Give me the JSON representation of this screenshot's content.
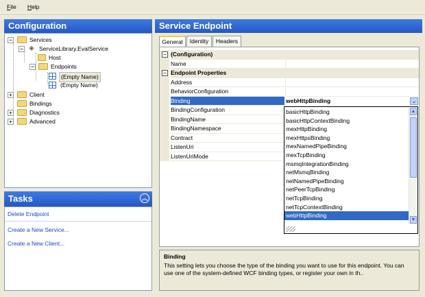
{
  "menu": {
    "file": {
      "underline": "F",
      "rest": "ile"
    },
    "help": {
      "underline": "H",
      "rest": "elp"
    }
  },
  "configuration": {
    "title": "Configuration",
    "tree": {
      "services": "Services",
      "service_library": "ServiceLibrary.EvalService",
      "host": "Host",
      "endpoints": "Endpoints",
      "empty_name_1": "(Empty Name)",
      "empty_name_2": "(Empty Name)",
      "client": "Client",
      "bindings": "Bindings",
      "diagnostics": "Diagnostics",
      "advanced": "Advanced"
    }
  },
  "tasks": {
    "title": "Tasks",
    "delete_endpoint": "Delete Endpoint",
    "create_service": "Create a New Service...",
    "create_client": "Create a New Client..."
  },
  "service_endpoint": {
    "title": "Service Endpoint",
    "tabs": [
      "General",
      "Identity",
      "Headers"
    ]
  },
  "properties": {
    "cat_configuration": "(Configuration)",
    "name": "Name",
    "cat_endpoint": "Endpoint Properties",
    "address": "Address",
    "behavior_configuration": "BehaviorConfiguration",
    "binding": "Binding",
    "binding_configuration": "BindingConfiguration",
    "binding_name": "BindingName",
    "binding_namespace": "BindingNamespace",
    "contract": "Contract",
    "listen_uri": "ListenUri",
    "listen_uri_mode": "ListenUriMode"
  },
  "binding_combo": {
    "value": "webHttpBinding",
    "options": [
      "basicHttpBinding",
      "basicHttpContextBinding",
      "mexHttpBinding",
      "mexHttpsBinding",
      "mexNamedPipeBinding",
      "mexTcpBinding",
      "msmqIntegrationBinding",
      "netMsmqBinding",
      "netNamedPipeBinding",
      "netPeerTcpBinding",
      "netTcpBinding",
      "netTcpContextBinding",
      "webHttpBinding"
    ],
    "selected_index": 12
  },
  "description": {
    "title": "Binding",
    "text": "This setting lets you choose the type of the binding you want to use for this endpoint. You can use one of the system-defined WCF binding types, or register your own in th.."
  }
}
